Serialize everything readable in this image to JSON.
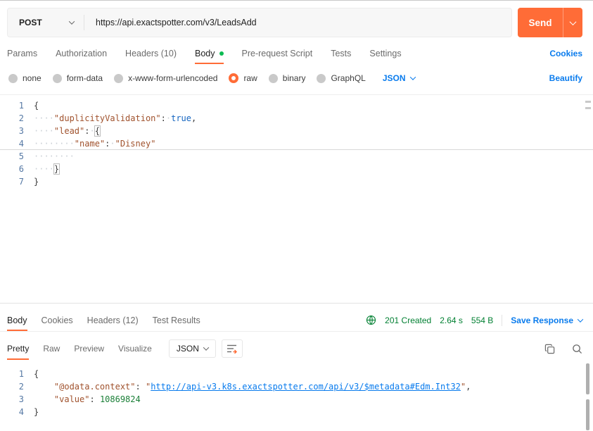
{
  "colors": {
    "accent": "#FF6C37",
    "link": "#097BED",
    "success": "#007F31"
  },
  "request": {
    "method": "POST",
    "url": "https://api.exactspotter.com/v3/LeadsAdd",
    "send_label": "Send",
    "cookies_link": "Cookies",
    "beautify_link": "Beautify",
    "language_select": "JSON",
    "tabs": [
      {
        "label": "Params"
      },
      {
        "label": "Authorization"
      },
      {
        "label": "Headers (10)"
      },
      {
        "label": "Body",
        "active": true,
        "dot": true
      },
      {
        "label": "Pre-request Script"
      },
      {
        "label": "Tests"
      },
      {
        "label": "Settings"
      }
    ],
    "body_types": [
      {
        "label": "none"
      },
      {
        "label": "form-data"
      },
      {
        "label": "x-www-form-urlencoded"
      },
      {
        "label": "raw",
        "selected": true
      },
      {
        "label": "binary"
      },
      {
        "label": "GraphQL"
      }
    ],
    "editor_lines": [
      {
        "tokens": [
          {
            "t": "{",
            "c": "punct"
          }
        ]
      },
      {
        "tokens": [
          {
            "t": "····",
            "c": "ws"
          },
          {
            "t": "\"duplicityValidation\"",
            "c": "key"
          },
          {
            "t": ":",
            "c": "punct"
          },
          {
            "t": "·",
            "c": "ws"
          },
          {
            "t": "true",
            "c": "bool"
          },
          {
            "t": ",",
            "c": "punct"
          }
        ]
      },
      {
        "tokens": [
          {
            "t": "····",
            "c": "ws"
          },
          {
            "t": "\"lead\"",
            "c": "key"
          },
          {
            "t": ":",
            "c": "punct"
          },
          {
            "t": "·",
            "c": "ws"
          },
          {
            "t": "{",
            "c": "bracket"
          }
        ]
      },
      {
        "active": true,
        "tokens": [
          {
            "t": "········",
            "c": "ws"
          },
          {
            "t": "\"name\"",
            "c": "key"
          },
          {
            "t": ":",
            "c": "punct"
          },
          {
            "t": "·",
            "c": "ws"
          },
          {
            "t": "\"Disney\"",
            "c": "string"
          }
        ]
      },
      {
        "tokens": [
          {
            "t": "········",
            "c": "ws"
          }
        ]
      },
      {
        "tokens": [
          {
            "t": "····",
            "c": "ws"
          },
          {
            "t": "}",
            "c": "bracket"
          }
        ]
      },
      {
        "tokens": [
          {
            "t": "}",
            "c": "punct"
          }
        ]
      }
    ]
  },
  "response": {
    "status": "201 Created",
    "time": "2.64 s",
    "size": "554 B",
    "save_response_label": "Save Response",
    "format_select": "JSON",
    "tabs": [
      {
        "label": "Body",
        "active": true
      },
      {
        "label": "Cookies"
      },
      {
        "label": "Headers (12)"
      },
      {
        "label": "Test Results"
      }
    ],
    "view_tabs": [
      {
        "label": "Pretty",
        "active": true
      },
      {
        "label": "Raw"
      },
      {
        "label": "Preview"
      },
      {
        "label": "Visualize"
      }
    ],
    "editor_lines": [
      {
        "tokens": [
          {
            "t": "{",
            "c": "punct"
          }
        ]
      },
      {
        "tokens": [
          {
            "t": "    ",
            "c": "sp"
          },
          {
            "t": "\"@odata.context\"",
            "c": "key"
          },
          {
            "t": ": ",
            "c": "punct"
          },
          {
            "t": "\"",
            "c": "string"
          },
          {
            "t": "http://api-v3.k8s.exactspotter.com/api/v3/$metadata#Edm.Int32",
            "c": "link"
          },
          {
            "t": "\"",
            "c": "string"
          },
          {
            "t": ",",
            "c": "punct"
          }
        ]
      },
      {
        "tokens": [
          {
            "t": "    ",
            "c": "sp"
          },
          {
            "t": "\"value\"",
            "c": "key"
          },
          {
            "t": ": ",
            "c": "punct"
          },
          {
            "t": "10869824",
            "c": "number"
          }
        ]
      },
      {
        "tokens": [
          {
            "t": "}",
            "c": "punct"
          }
        ]
      }
    ]
  }
}
